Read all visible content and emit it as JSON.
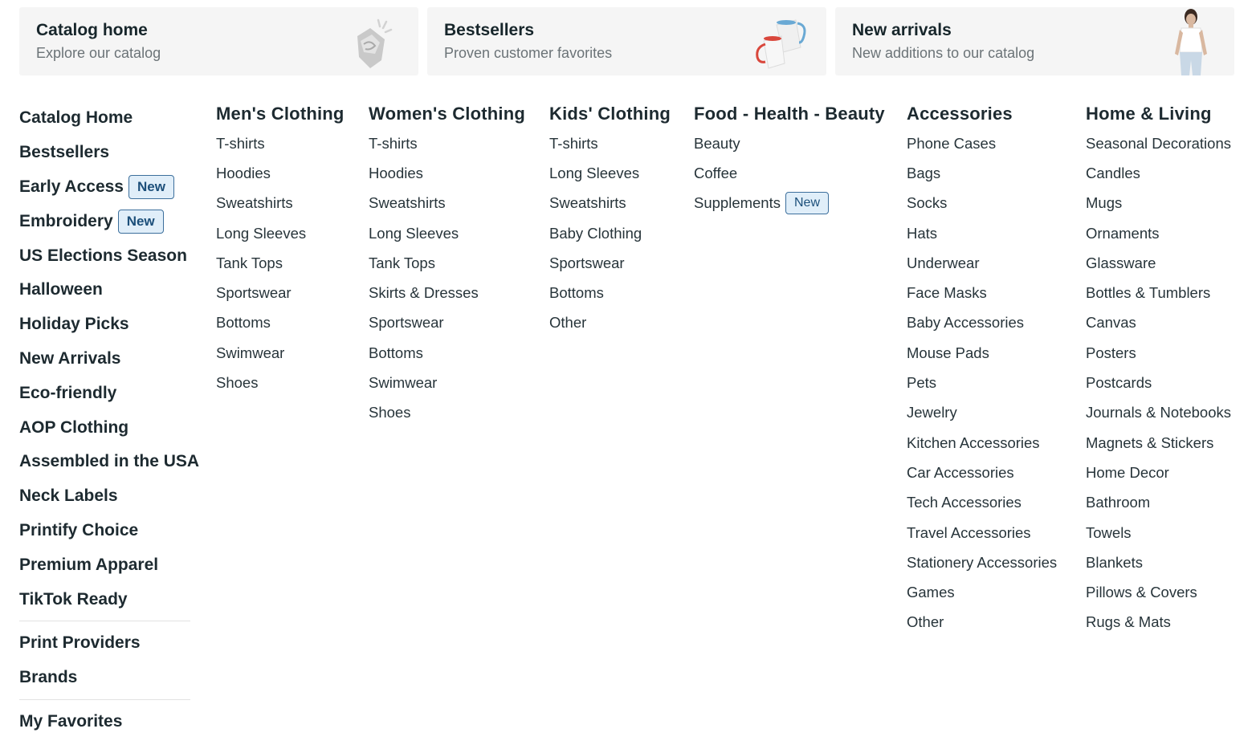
{
  "banners": [
    {
      "title": "Catalog home",
      "subtitle": "Explore our catalog",
      "icon": "gift-hand-icon"
    },
    {
      "title": "Bestsellers",
      "subtitle": "Proven customer favorites",
      "icon": "mugs-icon"
    },
    {
      "title": "New arrivals",
      "subtitle": "New additions to our catalog",
      "icon": "model-person-icon"
    }
  ],
  "sidebar": {
    "groups": [
      [
        {
          "label": "Catalog Home"
        },
        {
          "label": "Bestsellers"
        },
        {
          "label": "Early Access",
          "badge": "New"
        },
        {
          "label": "Embroidery",
          "badge": "New"
        },
        {
          "label": "US Elections Season"
        },
        {
          "label": "Halloween"
        },
        {
          "label": "Holiday Picks"
        },
        {
          "label": "New Arrivals"
        },
        {
          "label": "Eco-friendly"
        },
        {
          "label": "AOP Clothing"
        },
        {
          "label": "Assembled in the USA"
        },
        {
          "label": "Neck Labels"
        },
        {
          "label": "Printify Choice"
        },
        {
          "label": "Premium Apparel"
        },
        {
          "label": "TikTok Ready"
        }
      ],
      [
        {
          "label": "Print Providers"
        },
        {
          "label": "Brands"
        }
      ],
      [
        {
          "label": "My Favorites"
        }
      ]
    ]
  },
  "columns": [
    {
      "title": "Men's Clothing",
      "items": [
        {
          "label": "T-shirts"
        },
        {
          "label": "Hoodies"
        },
        {
          "label": "Sweatshirts"
        },
        {
          "label": "Long Sleeves"
        },
        {
          "label": "Tank Tops"
        },
        {
          "label": "Sportswear"
        },
        {
          "label": "Bottoms"
        },
        {
          "label": "Swimwear"
        },
        {
          "label": "Shoes"
        }
      ]
    },
    {
      "title": "Women's Clothing",
      "items": [
        {
          "label": "T-shirts"
        },
        {
          "label": "Hoodies"
        },
        {
          "label": "Sweatshirts"
        },
        {
          "label": "Long Sleeves"
        },
        {
          "label": "Tank Tops"
        },
        {
          "label": "Skirts & Dresses"
        },
        {
          "label": "Sportswear"
        },
        {
          "label": "Bottoms"
        },
        {
          "label": "Swimwear"
        },
        {
          "label": "Shoes"
        }
      ]
    },
    {
      "title": "Kids' Clothing",
      "items": [
        {
          "label": "T-shirts"
        },
        {
          "label": "Long Sleeves"
        },
        {
          "label": "Sweatshirts"
        },
        {
          "label": "Baby Clothing"
        },
        {
          "label": "Sportswear"
        },
        {
          "label": "Bottoms"
        },
        {
          "label": "Other"
        }
      ]
    },
    {
      "title": "Food - Health - Beauty",
      "items": [
        {
          "label": "Beauty"
        },
        {
          "label": "Coffee"
        },
        {
          "label": "Supplements",
          "badge": "New"
        }
      ]
    },
    {
      "title": "Accessories",
      "items": [
        {
          "label": "Phone Cases"
        },
        {
          "label": "Bags"
        },
        {
          "label": "Socks"
        },
        {
          "label": "Hats"
        },
        {
          "label": "Underwear"
        },
        {
          "label": "Face Masks"
        },
        {
          "label": "Baby Accessories"
        },
        {
          "label": "Mouse Pads"
        },
        {
          "label": "Pets"
        },
        {
          "label": "Jewelry"
        },
        {
          "label": "Kitchen Accessories"
        },
        {
          "label": "Car Accessories"
        },
        {
          "label": "Tech Accessories"
        },
        {
          "label": "Travel Accessories"
        },
        {
          "label": "Stationery Accessories"
        },
        {
          "label": "Games"
        },
        {
          "label": "Other"
        }
      ]
    },
    {
      "title": "Home & Living",
      "items": [
        {
          "label": "Seasonal Decorations"
        },
        {
          "label": "Candles"
        },
        {
          "label": "Mugs"
        },
        {
          "label": "Ornaments"
        },
        {
          "label": "Glassware"
        },
        {
          "label": "Bottles & Tumblers"
        },
        {
          "label": "Canvas"
        },
        {
          "label": "Posters"
        },
        {
          "label": "Postcards"
        },
        {
          "label": "Journals & Notebooks"
        },
        {
          "label": "Magnets & Stickers"
        },
        {
          "label": "Home Decor"
        },
        {
          "label": "Bathroom"
        },
        {
          "label": "Towels"
        },
        {
          "label": "Blankets"
        },
        {
          "label": "Pillows & Covers"
        },
        {
          "label": "Rugs & Mats"
        }
      ]
    }
  ]
}
